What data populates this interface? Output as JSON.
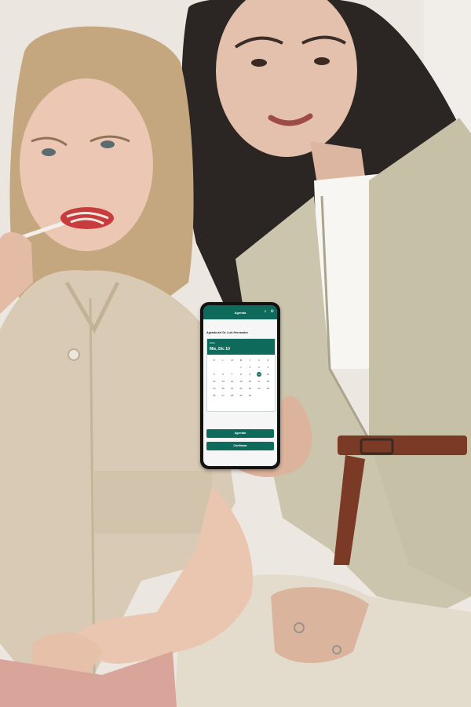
{
  "phone_app": {
    "title": "Agenda",
    "icons": [
      "search-icon",
      "settings-icon"
    ],
    "heading": "Agenda del Dr. Luis Hernandez",
    "calendar": {
      "year": "2022",
      "selected_date": "Mie, Dic 10",
      "weekdays": [
        "D",
        "L",
        "M",
        "M",
        "J",
        "V",
        "S"
      ],
      "days": [
        "",
        "",
        "",
        "1",
        "2",
        "3",
        "4",
        "5",
        "6",
        "7",
        "8",
        "9",
        "10",
        "11",
        "12",
        "13",
        "14",
        "15",
        "16",
        "17",
        "18",
        "19",
        "20",
        "21",
        "22",
        "23",
        "24",
        "25",
        "26",
        "27",
        "28",
        "29",
        "30",
        "",
        ""
      ],
      "selected_day": "10"
    },
    "buttons": {
      "primary": "Agendar",
      "secondary": "Confirmar"
    }
  },
  "colors": {
    "accent": "#0e6b5c",
    "background": "#ece8e1"
  }
}
